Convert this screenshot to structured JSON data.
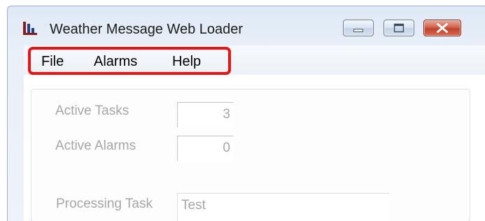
{
  "window": {
    "title": "Weather Message Web Loader",
    "icon": "weather-message-logo-icon",
    "controls": {
      "minimize": "minimize-icon",
      "maximize": "maximize-icon",
      "close": "close-icon"
    }
  },
  "menu": {
    "items": [
      {
        "label": "File"
      },
      {
        "label": "Alarms"
      },
      {
        "label": "Help"
      }
    ],
    "highlight_color": "#ee1111"
  },
  "form": {
    "active_tasks": {
      "label": "Active Tasks",
      "value": "3"
    },
    "active_alarms": {
      "label": "Active Alarms",
      "value": "0"
    },
    "processing_task": {
      "label": "Processing Task",
      "value": "Test"
    }
  }
}
